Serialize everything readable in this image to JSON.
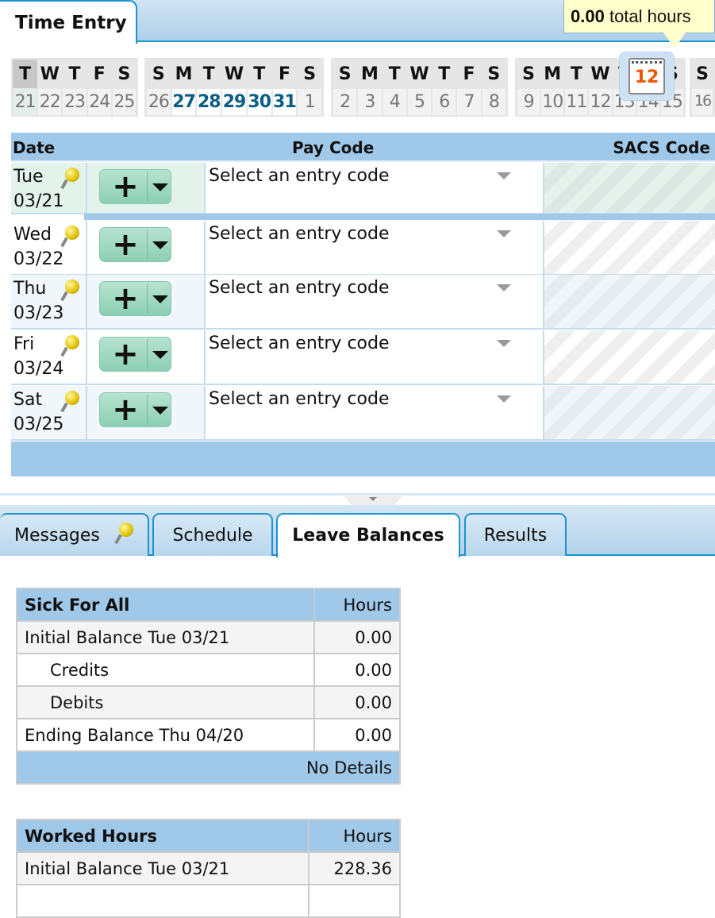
{
  "header": {
    "tab": "Time Entry",
    "total_value": "0.00",
    "total_label": "total hours",
    "calendar_icon_day": "12"
  },
  "calendar": {
    "weeks": [
      [
        {
          "l": "T",
          "n": "21",
          "s": "sel"
        },
        {
          "l": "W",
          "n": "22"
        },
        {
          "l": "T",
          "n": "23"
        },
        {
          "l": "F",
          "n": "24"
        },
        {
          "l": "S",
          "n": "25"
        }
      ],
      [
        {
          "l": "S",
          "n": "26"
        },
        {
          "l": "M",
          "n": "27",
          "s": "act"
        },
        {
          "l": "T",
          "n": "28",
          "s": "act"
        },
        {
          "l": "W",
          "n": "29",
          "s": "act"
        },
        {
          "l": "T",
          "n": "30",
          "s": "act"
        },
        {
          "l": "F",
          "n": "31",
          "s": "act"
        },
        {
          "l": "S",
          "n": "1"
        }
      ],
      [
        {
          "l": "S",
          "n": "2"
        },
        {
          "l": "M",
          "n": "3"
        },
        {
          "l": "T",
          "n": "4"
        },
        {
          "l": "W",
          "n": "5"
        },
        {
          "l": "T",
          "n": "6"
        },
        {
          "l": "F",
          "n": "7"
        },
        {
          "l": "S",
          "n": "8"
        }
      ],
      [
        {
          "l": "S",
          "n": "9"
        },
        {
          "l": "M",
          "n": "10"
        },
        {
          "l": "T",
          "n": "11"
        },
        {
          "l": "W",
          "n": "12"
        },
        {
          "l": "T",
          "n": "13"
        },
        {
          "l": "F",
          "n": "14"
        },
        {
          "l": "S",
          "n": "15"
        }
      ],
      [
        {
          "l": "S",
          "n": "16"
        }
      ]
    ]
  },
  "grid": {
    "columns": [
      "Date",
      "Pay Code",
      "SACS Code"
    ],
    "rows": [
      {
        "day": "Tue",
        "date": "03/21",
        "paycode": "Select an entry code"
      },
      {
        "day": "Wed",
        "date": "03/22",
        "paycode": "Select an entry code"
      },
      {
        "day": "Thu",
        "date": "03/23",
        "paycode": "Select an entry code"
      },
      {
        "day": "Fri",
        "date": "03/24",
        "paycode": "Select an entry code"
      },
      {
        "day": "Sat",
        "date": "03/25",
        "paycode": "Select an entry code"
      }
    ],
    "add_label": "+"
  },
  "bottom_tabs": [
    "Messages",
    "Schedule",
    "Leave Balances",
    "Results"
  ],
  "active_tab": "Leave Balances",
  "leave_tables": [
    {
      "title": "Sick For All",
      "hours_label": "Hours",
      "rows": [
        {
          "label": "Initial Balance Tue 03/21",
          "value": "0.00"
        },
        {
          "label": "Credits",
          "value": "0.00",
          "indent": true
        },
        {
          "label": "Debits",
          "value": "0.00",
          "indent": true
        },
        {
          "label": "Ending Balance Thu 04/20",
          "value": "0.00"
        }
      ],
      "footer": "No Details"
    },
    {
      "title": "Worked Hours",
      "hours_label": "Hours",
      "rows": [
        {
          "label": "Initial Balance Tue 03/21",
          "value": "228.36"
        }
      ]
    }
  ]
}
